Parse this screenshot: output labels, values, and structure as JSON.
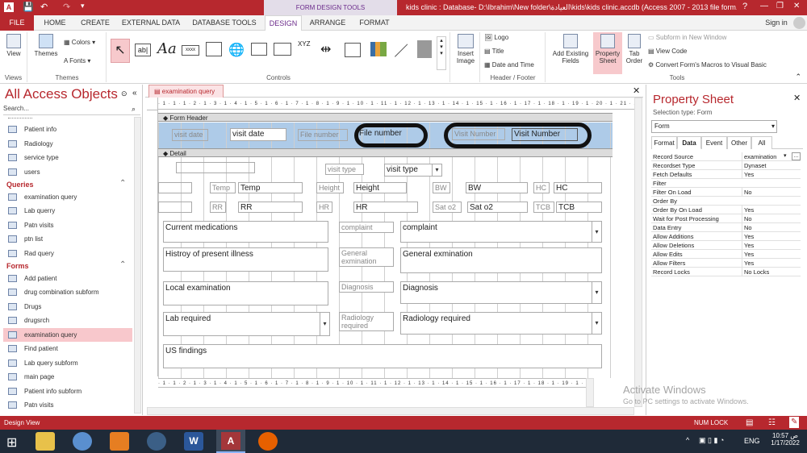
{
  "titlebar": {
    "context_label": "FORM DESIGN TOOLS",
    "window_title": "kids clinic : Database- D:\\Ibrahim\\New folder\\العيادة\\kids\\kids clinic.accdb (Access 2007 - 2013 file form...",
    "help": "?",
    "minimize": "—",
    "restore": "❐",
    "close": "✕"
  },
  "tabs": {
    "file": "FILE",
    "home": "HOME",
    "create": "CREATE",
    "external": "EXTERNAL DATA",
    "dbtools": "DATABASE TOOLS",
    "design": "DESIGN",
    "arrange": "ARRANGE",
    "format": "FORMAT",
    "signin": "Sign in"
  },
  "ribbon": {
    "view": "View",
    "themes": "Themes",
    "colors": "Colors",
    "fonts": "Fonts",
    "group_views": "Views",
    "group_themes": "Themes",
    "group_controls": "Controls",
    "insert_image": "Insert Image",
    "logo": "Logo",
    "title": "Title",
    "date_time": "Date and Time",
    "group_header": "Header / Footer",
    "add_fields": "Add Existing Fields",
    "property_sheet": "Property Sheet",
    "tab_order": "Tab Order",
    "subform_new": "Subform in New Window",
    "view_code": "View Code",
    "convert_macros": "Convert Form's Macros to Visual Basic",
    "group_tools": "Tools"
  },
  "nav": {
    "title": "All Access Objects",
    "search_placeholder": "Search...",
    "tables": [
      "Patient info",
      "Radiology",
      "service type",
      "users"
    ],
    "queries_head": "Queries",
    "queries": [
      "examination query",
      "Lab querry",
      "Patn visits",
      "ptn list",
      "Rad query"
    ],
    "forms_head": "Forms",
    "forms": [
      "Add patient",
      "drug combination subform",
      "Drugs",
      "drugsrch",
      "examination query",
      "Find patient",
      "Lab query subform",
      "main page",
      "Patient info subform",
      "Patn visits"
    ]
  },
  "document": {
    "tab_label": "examination query",
    "ruler_top": "· 1 · 1 · 1 · 2 · 1 · 3 · 1 · 4 · 1 · 5 · 1 · 6 · 1 · 7 · 1 · 8 · 1 · 9 · 1 · 10 · 1 · 11 · 1 · 12 · 1 · 13 · 1 · 14 · 1 · 15 · 1 · 16 · 1 · 17 · 1 · 18 · 1 · 19 · 1 · 20 · 1 · 21 · 1 · 22 · 1 · 23 · 1 · 24 · 1 · 25 ·",
    "ruler_bottom": "· 1 · 1 · 2 · 1 · 3 · 1 · 4 · 1 · 5 · 1 · 6 · 1 · 7 · 1 · 8 · 1 · 9 · 1 · 10 · 1 · 11 · 1 · 12 · 1 · 13 · 1 · 14 · 1 · 15 · 1 · 16 · 1 · 17 · 1 · 18 · 1 · 19 · 1 · 20 · 1 · 21 · 1 · 22",
    "form_header": "Form Header",
    "detail": "Detail",
    "header_controls": {
      "visit_date_label": "visit date",
      "visit_date_box": "visit date",
      "file_number_label": "File number",
      "file_number_box": "File number",
      "visit_number_label": "Visit Number",
      "visit_number_box": "Visit Number"
    },
    "detail_controls": {
      "visit_type_label": "visit type",
      "visit_type_box": "visit type",
      "temp_label": "Temp",
      "temp_box": "Temp",
      "height_label": "Height",
      "height_box": "Height",
      "bw_label": "BW",
      "bw_box": "BW",
      "hc_label": "HC",
      "hc_box": "HC",
      "rr_label": "RR",
      "rr_box": "RR",
      "hr_label": "HR",
      "hr_box": "HR",
      "sat_label": "Sat o2",
      "sat_box": "Sat o2",
      "tcb_label": "TCB",
      "tcb_box": "TCB",
      "current_meds": "Current medications",
      "complaint_label": "complaint",
      "complaint_box": "complaint",
      "history": "Histroy of present illness",
      "general_exam_label": "General exmination",
      "general_exam_box": "General exmination",
      "local_exam": "Local examination",
      "diagnosis_label": "Diagnosis",
      "diagnosis_box": "Diagnosis",
      "lab_required": "Lab required",
      "radiology_label": "Radiology required",
      "radiology_box": "Radiology required",
      "us_findings": "US findings"
    }
  },
  "property_sheet": {
    "title": "Property Sheet",
    "selection_type": "Selection type:  Form",
    "selector_value": "Form",
    "tabs": [
      "Format",
      "Data",
      "Event",
      "Other",
      "All"
    ],
    "active_tab": "Data",
    "rows": [
      {
        "name": "Record Source",
        "value": "examination"
      },
      {
        "name": "Recordset Type",
        "value": "Dynaset"
      },
      {
        "name": "Fetch Defaults",
        "value": "Yes"
      },
      {
        "name": "Filter",
        "value": ""
      },
      {
        "name": "Filter On Load",
        "value": "No"
      },
      {
        "name": "Order By",
        "value": ""
      },
      {
        "name": "Order By On Load",
        "value": "Yes"
      },
      {
        "name": "Wait for Post Processing",
        "value": "No"
      },
      {
        "name": "Data Entry",
        "value": "No"
      },
      {
        "name": "Allow Additions",
        "value": "Yes"
      },
      {
        "name": "Allow Deletions",
        "value": "Yes"
      },
      {
        "name": "Allow Edits",
        "value": "Yes"
      },
      {
        "name": "Allow Filters",
        "value": "Yes"
      },
      {
        "name": "Record Locks",
        "value": "No Locks"
      }
    ]
  },
  "watermark": {
    "line1": "Activate Windows",
    "line2": "Go to PC settings to activate Windows."
  },
  "status": {
    "left": "Design View",
    "numlock": "NUM LOCK"
  },
  "taskbar": {
    "lang": "ENG",
    "time": "10:57 ص",
    "date": "1/17/2022"
  },
  "colors": {
    "accent": "#b7282e",
    "context_tab": "#6b2b8b",
    "header_band": "#aecbe8",
    "selected_nav": "#f8c8cc"
  }
}
